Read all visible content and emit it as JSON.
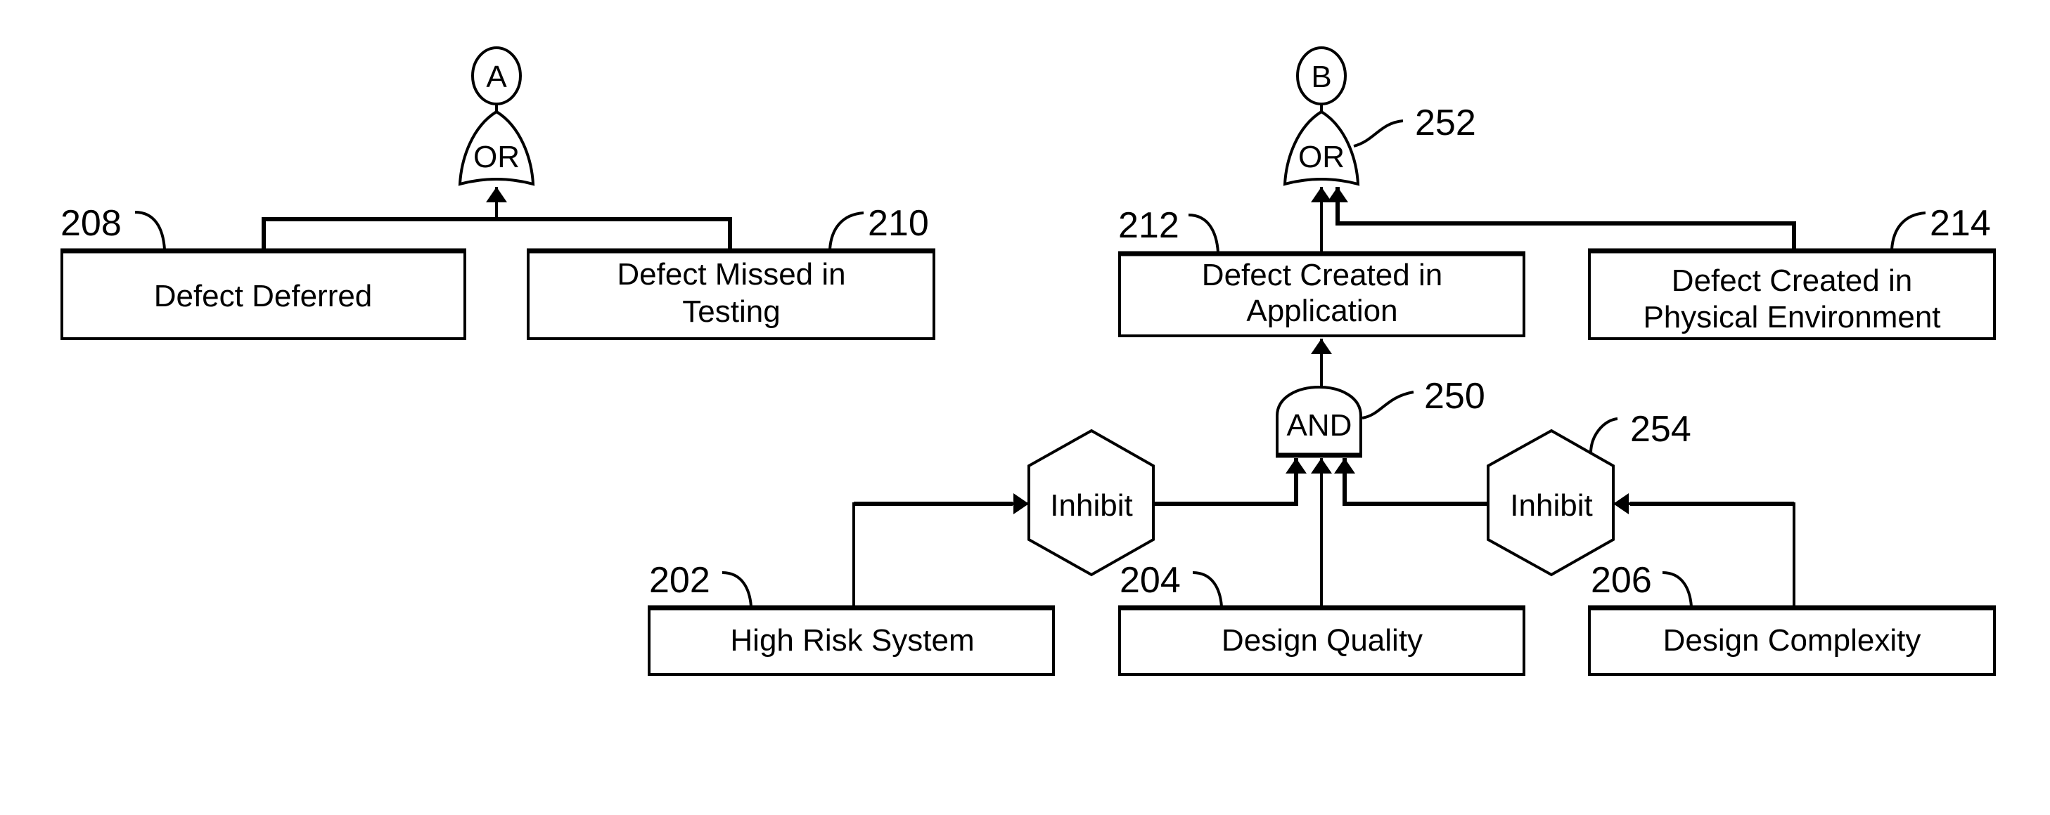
{
  "diagram": {
    "connectors": [
      {
        "id": "A",
        "label": "A"
      },
      {
        "id": "B",
        "label": "B"
      }
    ],
    "gates": [
      {
        "id": "or_a",
        "type": "OR",
        "label": "OR",
        "ref": ""
      },
      {
        "id": "or_b",
        "type": "OR",
        "label": "OR",
        "ref": "252"
      },
      {
        "id": "and",
        "type": "AND",
        "label": "AND",
        "ref": "250"
      },
      {
        "id": "inhibit_1",
        "type": "Inhibit",
        "label": "Inhibit",
        "ref": ""
      },
      {
        "id": "inhibit_2",
        "type": "Inhibit",
        "label": "Inhibit",
        "ref": "254"
      }
    ],
    "events": [
      {
        "ref": "208",
        "lines": [
          "Defect Deferred"
        ]
      },
      {
        "ref": "210",
        "lines": [
          "Defect Missed in",
          "Testing"
        ]
      },
      {
        "ref": "212",
        "lines": [
          "Defect Created in",
          "Application"
        ]
      },
      {
        "ref": "214",
        "lines": [
          "Defect Created in",
          "Physical Environment"
        ]
      },
      {
        "ref": "202",
        "lines": [
          "High Risk System"
        ]
      },
      {
        "ref": "204",
        "lines": [
          "Design Quality"
        ]
      },
      {
        "ref": "206",
        "lines": [
          "Design Complexity"
        ]
      }
    ],
    "edges": [
      {
        "from": "208",
        "to": "or_a"
      },
      {
        "from": "210",
        "to": "or_a"
      },
      {
        "from": "or_a",
        "to": "A"
      },
      {
        "from": "212",
        "to": "or_b"
      },
      {
        "from": "214",
        "to": "or_b"
      },
      {
        "from": "or_b",
        "to": "B"
      },
      {
        "from": "and",
        "to": "212"
      },
      {
        "from": "inhibit_1",
        "to": "and"
      },
      {
        "from": "204",
        "to": "and"
      },
      {
        "from": "inhibit_2",
        "to": "and"
      },
      {
        "from": "202",
        "to": "inhibit_1"
      },
      {
        "from": "206",
        "to": "inhibit_2"
      }
    ]
  }
}
